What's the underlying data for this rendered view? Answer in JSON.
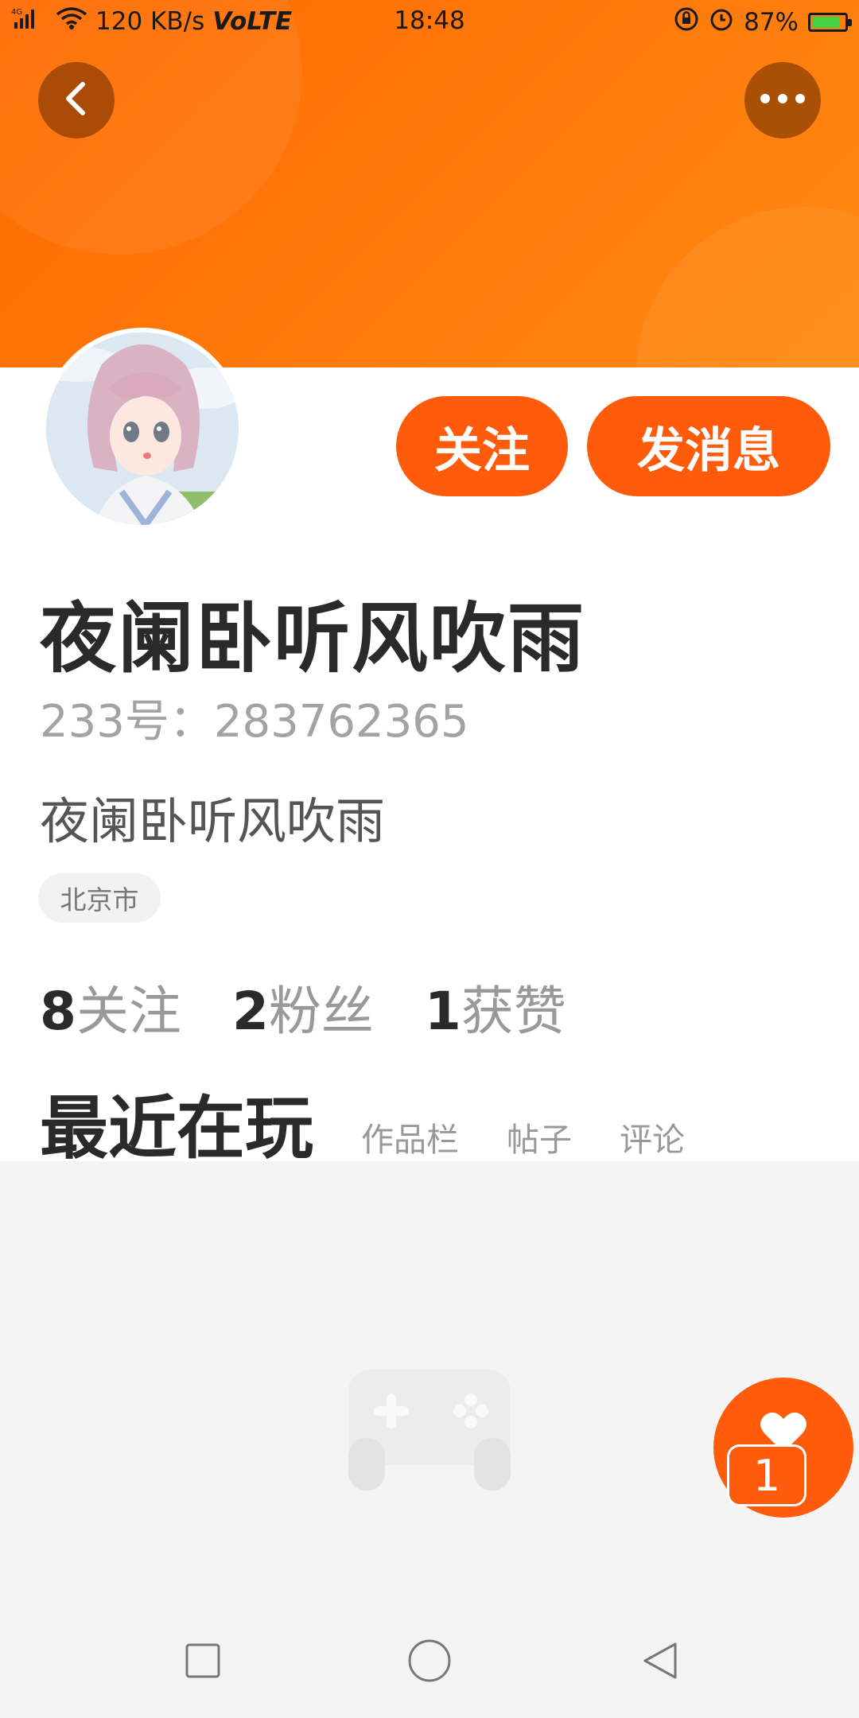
{
  "status_bar": {
    "network": "4G",
    "speed": "120 KB/s",
    "volte": "VoLTE",
    "time": "18:48",
    "battery": "87%",
    "battery_level": 0.87
  },
  "header": {
    "back_icon": "chevron-left-icon",
    "more_icon": "more-horizontal-icon"
  },
  "profile": {
    "follow_label": "关注",
    "message_label": "发消息",
    "name": "夜阑卧听风吹雨",
    "id_text": "233号：283762365",
    "bio": "夜阑卧听风吹雨",
    "location": "北京市"
  },
  "stats": [
    {
      "count": "8",
      "label": "关注"
    },
    {
      "count": "2",
      "label": "粉丝"
    },
    {
      "count": "1",
      "label": "获赞"
    }
  ],
  "tabs": {
    "active": "最近在玩",
    "items": [
      "作品栏",
      "帖子",
      "评论"
    ]
  },
  "like_fab": {
    "icon": "heart-icon",
    "count": "1"
  },
  "nav": {
    "items": [
      "square-icon",
      "circle-icon",
      "triangle-back-icon"
    ]
  },
  "colors": {
    "accent": "#ff5b0a",
    "banner": "#ff7a0c"
  }
}
